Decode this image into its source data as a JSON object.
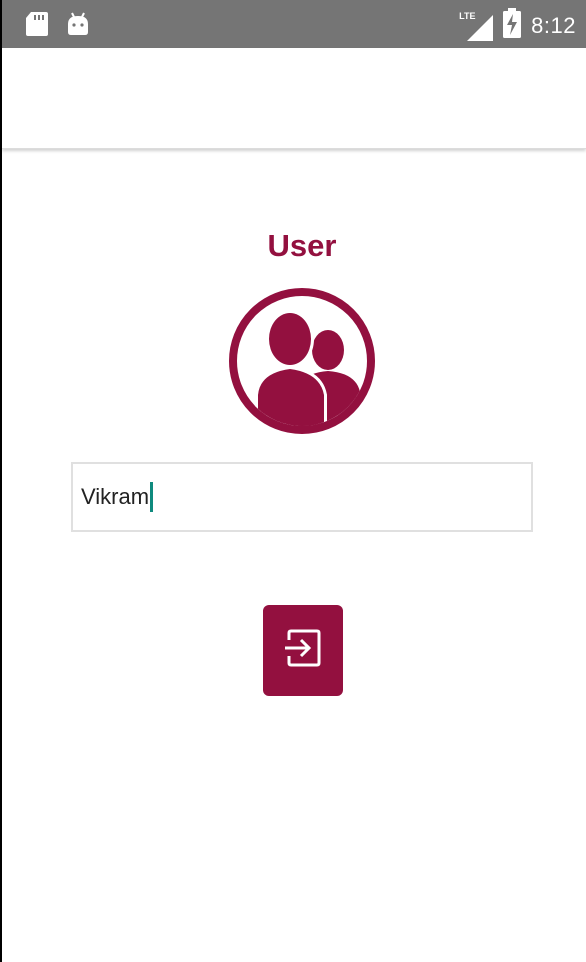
{
  "status_bar": {
    "time": "8:12",
    "network_label": "LTE",
    "icons": [
      "sd-card-icon",
      "android-icon",
      "lte-signal-icon",
      "battery-charging-icon"
    ]
  },
  "main": {
    "title": "User",
    "avatar_icon": "user-group-icon",
    "name_input": {
      "value": "Vikram"
    },
    "login_button_icon": "login-arrow-icon"
  },
  "colors": {
    "accent": "#93103f",
    "status_bar": "#757575",
    "caret": "#0f8a7e"
  }
}
